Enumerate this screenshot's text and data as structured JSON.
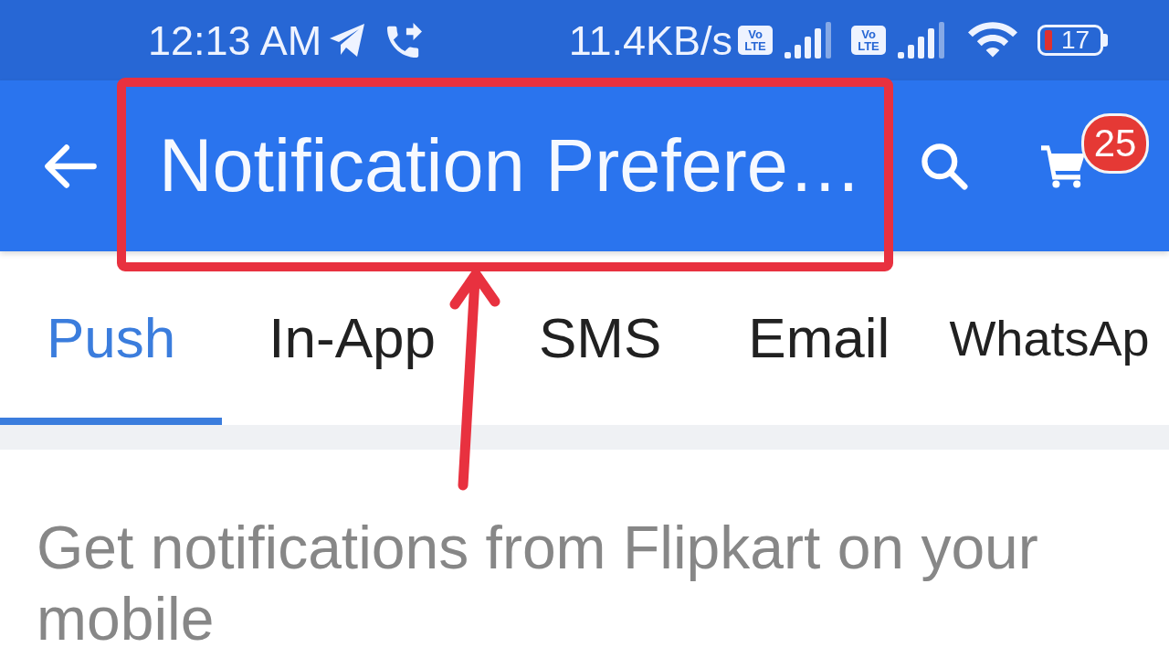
{
  "status_bar": {
    "time": "12:13 AM",
    "network_speed": "11.4KB/s",
    "sims": [
      {
        "badge_top": "Vo",
        "badge_bottom": "LTE"
      },
      {
        "badge_top": "Vo",
        "badge_bottom": "LTE"
      }
    ],
    "battery_percent": "17"
  },
  "app_bar": {
    "title": "Notification Prefere…",
    "cart_count": "25"
  },
  "tabs": [
    {
      "label": "Push",
      "selected": true
    },
    {
      "label": "In-App",
      "selected": false
    },
    {
      "label": "SMS",
      "selected": false
    },
    {
      "label": "Email",
      "selected": false
    },
    {
      "label": "WhatsAp",
      "selected": false
    }
  ],
  "description": "Get notifications from Flipkart on your mobile",
  "annotations": {
    "highlight_frame": true,
    "arrow": true
  }
}
